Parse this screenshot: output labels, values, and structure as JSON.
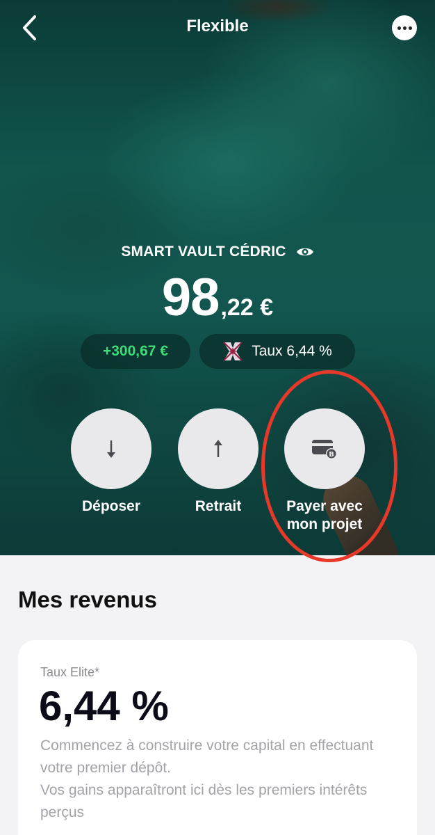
{
  "header": {
    "title": "Flexible",
    "back_icon": "chevron-left-icon",
    "more_icon": "more-horizontal-icon"
  },
  "vault": {
    "name": "SMART VAULT CÉDRIC",
    "visibility_icon": "eye-icon",
    "balance_integer": "98",
    "balance_decimal": ",22 €",
    "gain": "+300,67 €",
    "rate": "Taux 6,44 %"
  },
  "actions": [
    {
      "label": "Déposer",
      "icon": "arrow-down-icon"
    },
    {
      "label": "Retrait",
      "icon": "arrow-up-icon"
    },
    {
      "label_line1": "Payer avec",
      "label_line2": "mon projet",
      "icon": "card-bitcoin-icon"
    }
  ],
  "earnings": {
    "title": "Mes revenus",
    "rate_label": "Taux Elite*",
    "rate_value": "6,44 %",
    "description_1": "Commencez à construire votre capital en effectuant votre premier dépôt.",
    "description_2": "Vos gains apparaîtront ici dès les premiers intérêts perçus"
  },
  "colors": {
    "gain_green": "#3ddc76",
    "highlight_red": "#e7392a",
    "hero_teal": "#12564f"
  }
}
